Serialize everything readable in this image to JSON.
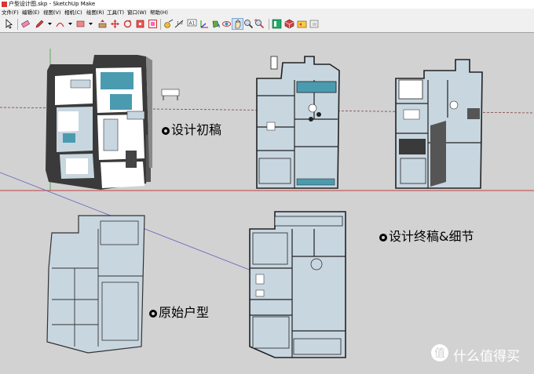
{
  "window": {
    "title": "户型设计图.skp - SketchUp Make"
  },
  "menu": {
    "items": [
      {
        "label": "文件(F)"
      },
      {
        "label": "编辑(E)"
      },
      {
        "label": "视图(V)"
      },
      {
        "label": "相机(C)"
      },
      {
        "label": "绘图(R)"
      },
      {
        "label": "工具(T)"
      },
      {
        "label": "窗口(W)"
      },
      {
        "label": "帮助(H)"
      }
    ]
  },
  "toolbar": {
    "icons": [
      "select-icon",
      "eraser-icon",
      "pencil-icon",
      "arc-icon",
      "shape-icon",
      "push-pull-icon",
      "move-icon",
      "rotate-icon",
      "scale-icon",
      "offset-icon",
      "tape-icon",
      "text-icon",
      "axes-icon",
      "paint-icon",
      "orbit-icon",
      "pan-icon",
      "zoom-icon",
      "zoom-extents-icon",
      "warehouse-icon",
      "components-icon",
      "share-icon",
      "extension-icon"
    ],
    "active": "pan-icon"
  },
  "scene": {
    "labels": {
      "first_draft": "设计初稿",
      "final_draft": "设计终稿&细节",
      "original": "原始户型"
    },
    "colors": {
      "floor": "#c8d6e0",
      "wall": "#ffffff",
      "wall_dark": "#3a3a3a",
      "glass": "#4a9bb0",
      "red_axis": "#c24040",
      "background": "#d2d2d2"
    }
  },
  "watermark": {
    "text": "什么值得买"
  }
}
